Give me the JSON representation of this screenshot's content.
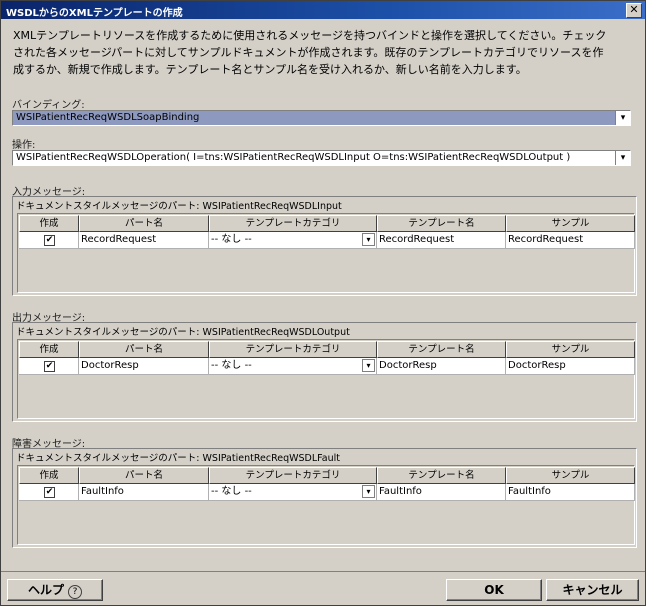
{
  "window": {
    "title": "WSDLからのXMLテンプレートの作成",
    "close_label": "✕"
  },
  "description": "XMLテンプレートリソースを作成するために使用されるメッセージを持つバインドと操作を選択してください。チェックされた各メッセージパートに対してサンプルドキュメントが作成されます。既存のテンプレートカテゴリでリソースを作成するか、新規で作成します。テンプレート名とサンプル名を受け入れるか、新しい名前を入力します。",
  "binding": {
    "label": "バインディング:",
    "value": "WSIPatientRecReqWSDLSoapBinding"
  },
  "operation": {
    "label": "操作:",
    "value": "WSIPatientRecReqWSDLOperation( I=tns:WSIPatientRecReqWSDLInput O=tns:WSIPatientRecReqWSDLOutput )"
  },
  "columns": [
    "作成",
    "パート名",
    "テンプレートカテゴリ",
    "テンプレート名",
    "サンプル"
  ],
  "sections": [
    {
      "label": "入力メッセージ:",
      "group_title": "ドキュメントスタイルメッセージのパート: WSIPatientRecReqWSDLInput",
      "row": {
        "checked": "✔",
        "part": "RecordRequest",
        "category": "-- なし --",
        "template": "RecordRequest",
        "sample": "RecordRequest"
      }
    },
    {
      "label": "出力メッセージ:",
      "group_title": "ドキュメントスタイルメッセージのパート: WSIPatientRecReqWSDLOutput",
      "row": {
        "checked": "✔",
        "part": "DoctorResp",
        "category": "-- なし --",
        "template": "DoctorResp",
        "sample": "DoctorResp"
      }
    },
    {
      "label": "障害メッセージ:",
      "group_title": "ドキュメントスタイルメッセージのパート: WSIPatientRecReqWSDLFault",
      "row": {
        "checked": "✔",
        "part": "FaultInfo",
        "category": "-- なし --",
        "template": "FaultInfo",
        "sample": "FaultInfo"
      }
    }
  ],
  "buttons": {
    "help": "ヘルプ",
    "help_icon": "?",
    "ok": "OK",
    "cancel": "キャンセル"
  }
}
